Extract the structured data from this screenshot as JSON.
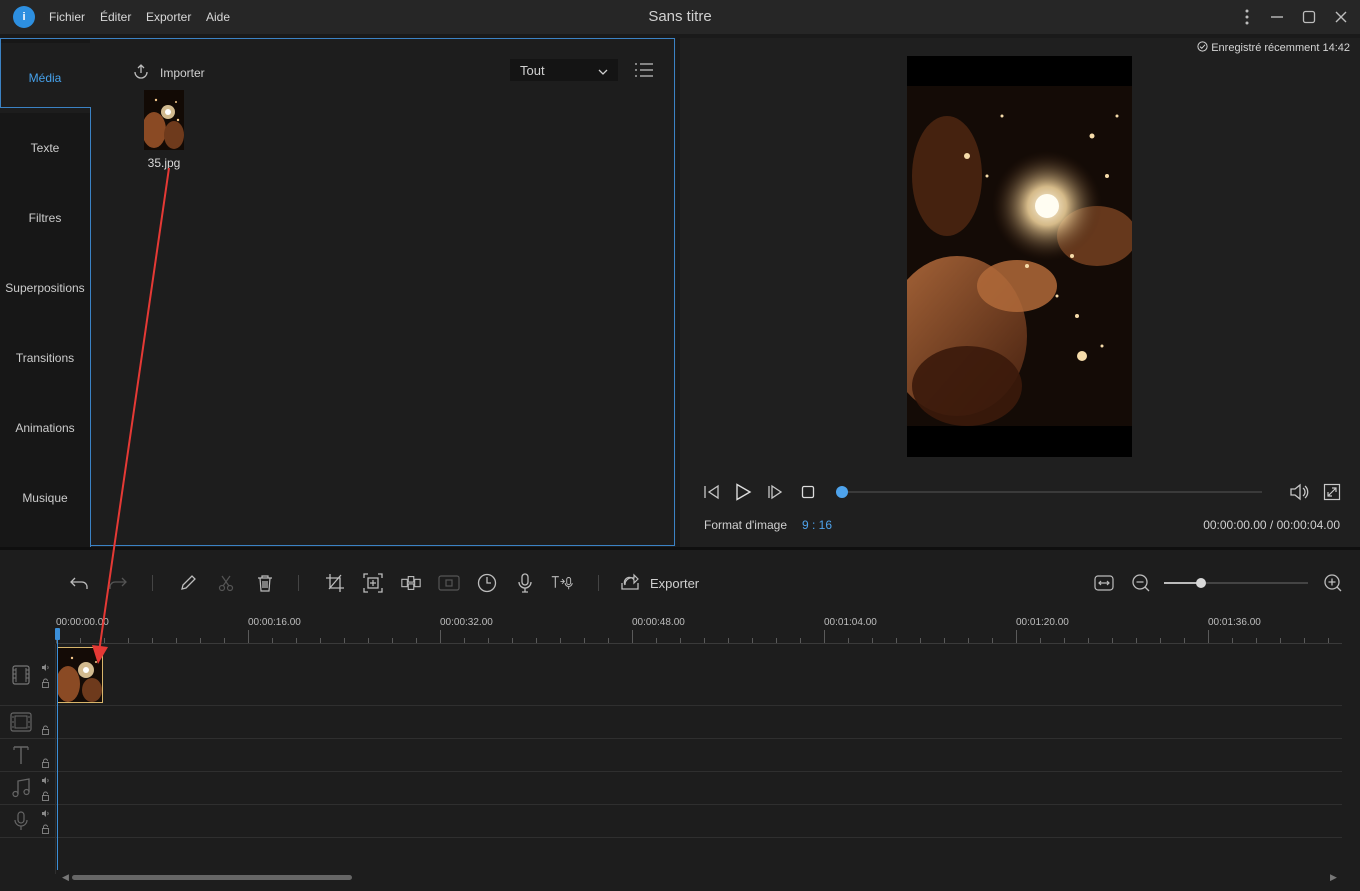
{
  "window": {
    "title": "Sans titre",
    "menu": [
      "Fichier",
      "Éditer",
      "Exporter",
      "Aide"
    ],
    "logo_text": "i"
  },
  "sidebar": {
    "tabs": [
      "Média",
      "Texte",
      "Filtres",
      "Superpositions",
      "Transitions",
      "Animations",
      "Musique"
    ],
    "active_tab": "Média"
  },
  "media": {
    "import_label": "Importer",
    "filter_value": "Tout",
    "items": [
      {
        "name": "35.jpg"
      }
    ]
  },
  "preview": {
    "saved_status": "Enregistré récemment 14:42",
    "aspect_label": "Format d'image",
    "aspect_value": "9 : 16",
    "time_current": "00:00:00.00",
    "time_total": "00:00:04.00",
    "time_readout": "00:00:00.00 / 00:00:04.00",
    "progress": 0.0
  },
  "timeline": {
    "toolbar": {
      "export_label": "Exporter"
    },
    "zoom_level": 0.26,
    "ruler_labels": [
      "00:00:00.00",
      "00:00:16.00",
      "00:00:32.00",
      "00:00:48.00",
      "00:01:04.00",
      "00:01:20.00",
      "00:01:36.00"
    ],
    "tracks": [
      "video",
      "overlay",
      "text",
      "music",
      "voice"
    ]
  },
  "colors": {
    "accent": "#4ea3ec",
    "clip_border": "#d7b56b",
    "annotation_arrow": "#e53935"
  }
}
